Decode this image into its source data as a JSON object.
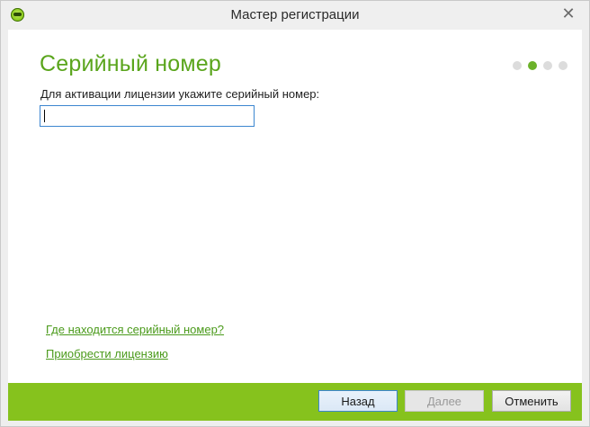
{
  "window": {
    "title": "Мастер регистрации",
    "close_glyph": "✕"
  },
  "page": {
    "heading": "Серийный номер",
    "prompt": "Для активации лицензии укажите серийный номер:",
    "serial_value": "",
    "steps": {
      "total": 4,
      "current": 2
    }
  },
  "links": {
    "where_serial": "Где находится серийный номер?",
    "buy_license": "Приобрести лицензию"
  },
  "buttons": {
    "back": "Назад",
    "next": "Далее",
    "cancel": "Отменить"
  },
  "colors": {
    "accent": "#5aa51c",
    "footer": "#86c21d",
    "focus": "#3c86d0"
  },
  "icons": {
    "app": "app-logo-icon",
    "close": "close-icon"
  }
}
